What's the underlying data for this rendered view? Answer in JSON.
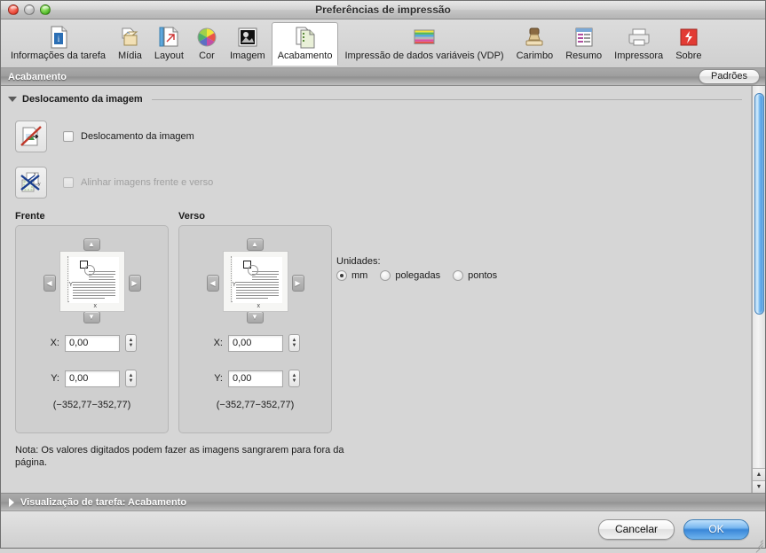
{
  "window": {
    "title": "Preferências de impressão",
    "controls": {
      "close": "close-button",
      "minimize": "minimize-button",
      "zoom": "zoom-button"
    }
  },
  "toolbar": {
    "items": [
      {
        "label": "Informações da tarefa",
        "icon": "job-info-icon",
        "active": false
      },
      {
        "label": "Mídia",
        "icon": "media-icon",
        "active": false
      },
      {
        "label": "Layout",
        "icon": "layout-icon",
        "active": false
      },
      {
        "label": "Cor",
        "icon": "color-wheel-icon",
        "active": false
      },
      {
        "label": "Imagem",
        "icon": "image-icon",
        "active": false
      },
      {
        "label": "Acabamento",
        "icon": "finishing-icon",
        "active": true
      },
      {
        "label": "Impressão de dados variáveis (VDP)",
        "icon": "vdp-icon",
        "active": false
      },
      {
        "label": "Carimbo",
        "icon": "stamp-icon",
        "active": false
      },
      {
        "label": "Resumo",
        "icon": "summary-icon",
        "active": false
      },
      {
        "label": "Impressora",
        "icon": "printer-icon",
        "active": false
      },
      {
        "label": "Sobre",
        "icon": "about-icon",
        "active": false
      }
    ]
  },
  "pane_header": {
    "title": "Acabamento",
    "defaults_button": "Padrões"
  },
  "section": {
    "title": "Deslocamento da imagem",
    "expanded": true,
    "options": [
      {
        "label": "Deslocamento da imagem",
        "checked": false,
        "disabled": false,
        "icon": "image-shift-disabled-icon"
      },
      {
        "label": "Alinhar imagens frente e verso",
        "checked": false,
        "disabled": true,
        "icon": "align-front-back-disabled-icon"
      }
    ]
  },
  "units": {
    "label": "Unidades:",
    "options": [
      {
        "label": "mm",
        "selected": true
      },
      {
        "label": "polegadas",
        "selected": false
      },
      {
        "label": "pontos",
        "selected": false
      }
    ]
  },
  "panels": [
    {
      "title": "Frente",
      "x_label": "X:",
      "x_value": "0,00",
      "y_label": "Y:",
      "y_value": "0,00",
      "range": "(−352,77−352,77)",
      "axis_x": "x",
      "axis_y": "Y"
    },
    {
      "title": "Verso",
      "x_label": "X:",
      "x_value": "0,00",
      "y_label": "Y:",
      "y_value": "0,00",
      "range": "(−352,77−352,77)",
      "axis_x": "x",
      "axis_y": "Y"
    }
  ],
  "note": "Nota: Os valores digitados podem fazer as imagens sangrarem para fora da página.",
  "preview_band": {
    "title": "Visualização de tarefa: Acabamento",
    "expanded": false
  },
  "footer": {
    "cancel": "Cancelar",
    "ok": "OK"
  },
  "colors": {
    "accent_blue": "#3a87d8",
    "scrollbar_thumb": "#6db4ef",
    "band_text": "#ffffff"
  }
}
